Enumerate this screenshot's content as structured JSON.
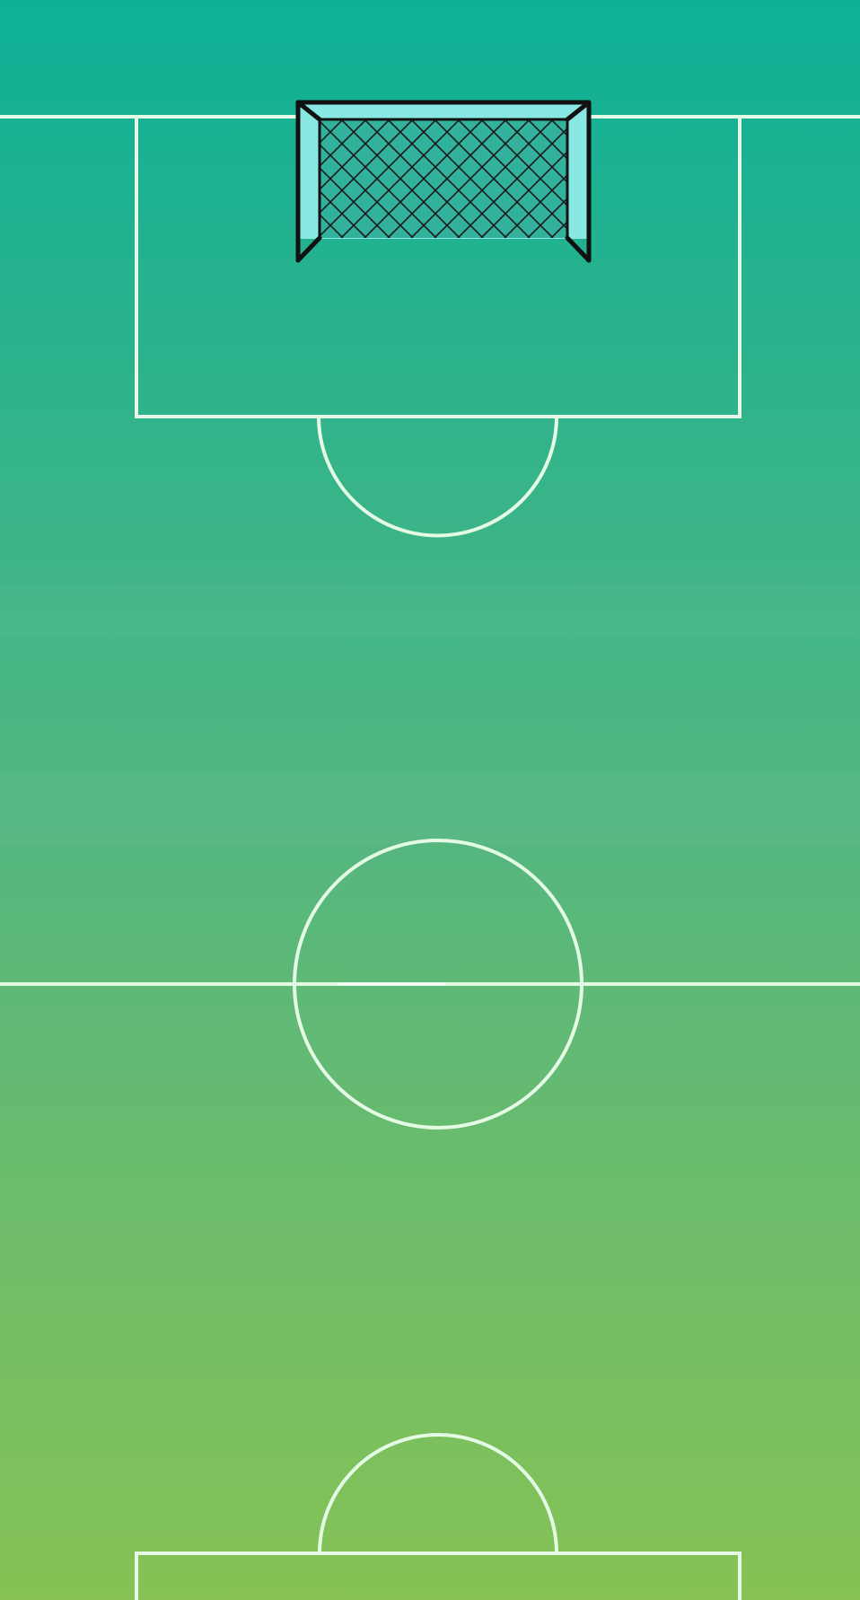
{
  "colors": {
    "grass_top": "#0db096",
    "grass_mid": "#52b681",
    "grass_bottom": "#86c255",
    "line": "#e4fae4",
    "goal_frame": "#111111",
    "goal_net": "#1a1a1a",
    "goal_back": "#8ae8e4"
  },
  "icons": {
    "goal": "soccer-goal-icon",
    "pitch": "soccer-pitch"
  }
}
